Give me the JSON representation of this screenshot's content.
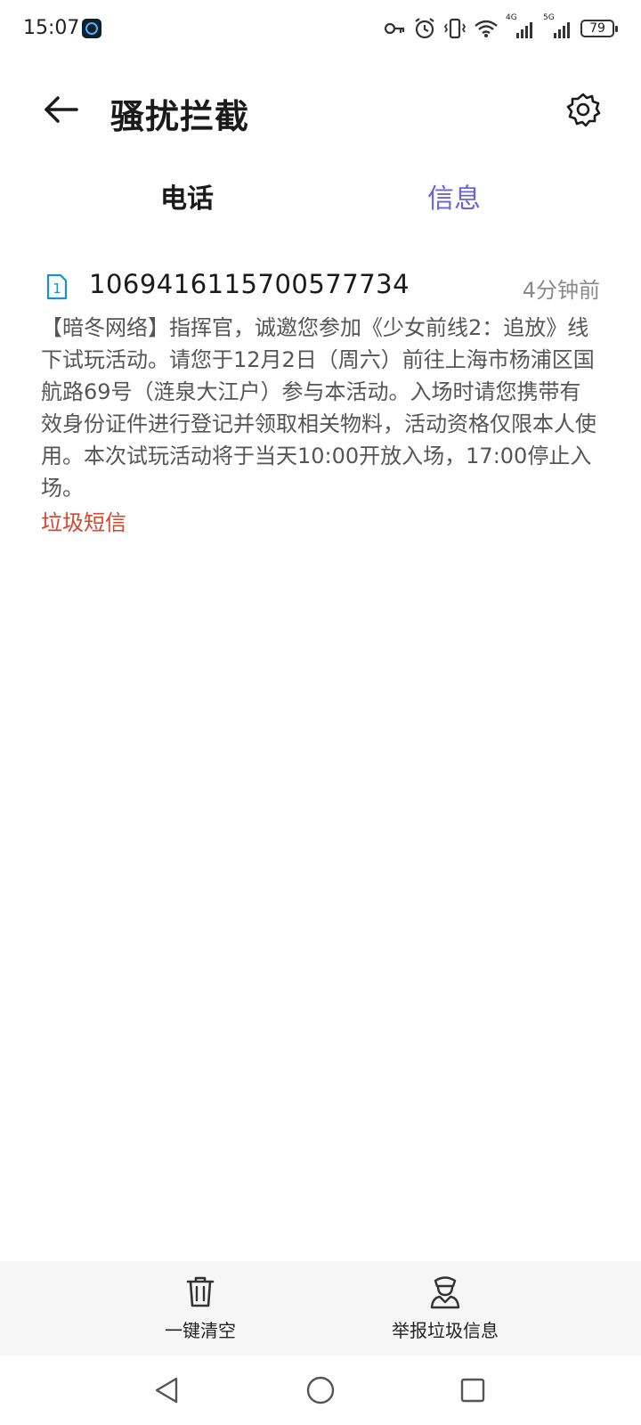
{
  "status_bar": {
    "time": "15:07",
    "net1": "4G",
    "net2": "5G",
    "battery": "79",
    "icons": [
      "app-icon",
      "key-icon",
      "alarm-icon",
      "vibrate-icon",
      "wifi-icon",
      "signal-icon",
      "battery-icon"
    ]
  },
  "header": {
    "title": "骚扰拦截",
    "back_icon": "arrow-left-icon",
    "settings_icon": "gear-icon"
  },
  "tabs": [
    {
      "label": "电话",
      "selected": false
    },
    {
      "label": "信息",
      "selected": true
    }
  ],
  "messages": [
    {
      "sim": "1",
      "sender": "10694161157005777 34",
      "time": "4分钟前",
      "body": "【暗冬网络】指挥官，诚邀您参加《少女前线2：追放》线下试玩活动。请您于12月2日（周六）前往上海市杨浦区国航路69号（涟泉大江户）参与本活动。入场时请您携带有效身份证件进行登记并领取相关物料，活动资格仅限本人使用。本次试玩活动将于当天10:00开放入场，17:00停止入场。",
      "tag": "垃圾短信"
    }
  ],
  "actions": {
    "clear_label": "一键清空",
    "report_label": "举报垃圾信息"
  },
  "colors": {
    "accent": "#6a63e0",
    "spam_tag": "#d9442f",
    "sim_icon": "#1a8fd0"
  }
}
